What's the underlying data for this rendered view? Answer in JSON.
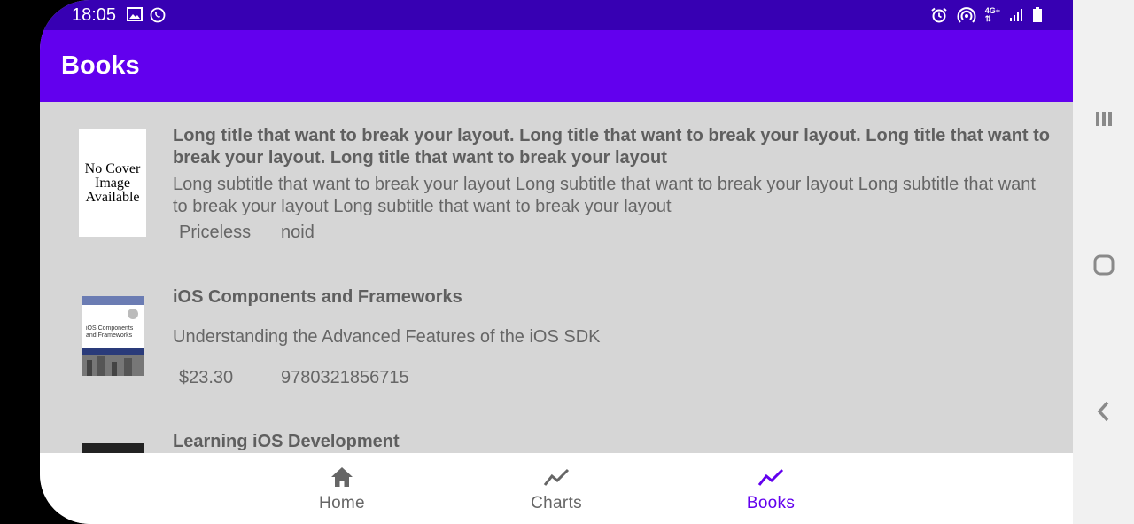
{
  "status_bar": {
    "time": "18:05",
    "left_icons": [
      "image-icon",
      "whatsapp-icon"
    ],
    "right_icons": [
      "alarm-icon",
      "hotspot-icon",
      "network-4g-icon",
      "signal-icon",
      "battery-icon"
    ],
    "network_label": "4G+"
  },
  "app_bar": {
    "title": "Books"
  },
  "books": [
    {
      "cover": "No Cover Image Available",
      "title": "Long title that want to break your layout. Long title that want to break your layout. Long title that want to break your layout. Long title that want to break your layout",
      "subtitle": "Long subtitle that want to break your layout Long subtitle that want to break your layout Long subtitle that want to break your layout Long subtitle that want to break your layout",
      "price": "Priceless",
      "isbn": "noid"
    },
    {
      "cover": "iOS Components and Frameworks",
      "title": "iOS Components and Frameworks",
      "subtitle": "Understanding the Advanced Features of the iOS SDK",
      "price": "$23.30",
      "isbn": "9780321856715"
    },
    {
      "title": "Learning iOS Development"
    }
  ],
  "bottom_nav": {
    "items": [
      {
        "label": "Home",
        "icon": "home-icon",
        "active": false
      },
      {
        "label": "Charts",
        "icon": "trend-line-icon",
        "active": false
      },
      {
        "label": "Books",
        "icon": "trend-line-icon",
        "active": true
      }
    ]
  },
  "colors": {
    "status_bar": "#3700b3",
    "app_bar": "#6200ee",
    "active_nav": "#6200ee",
    "list_background": "#d6d6d6"
  }
}
